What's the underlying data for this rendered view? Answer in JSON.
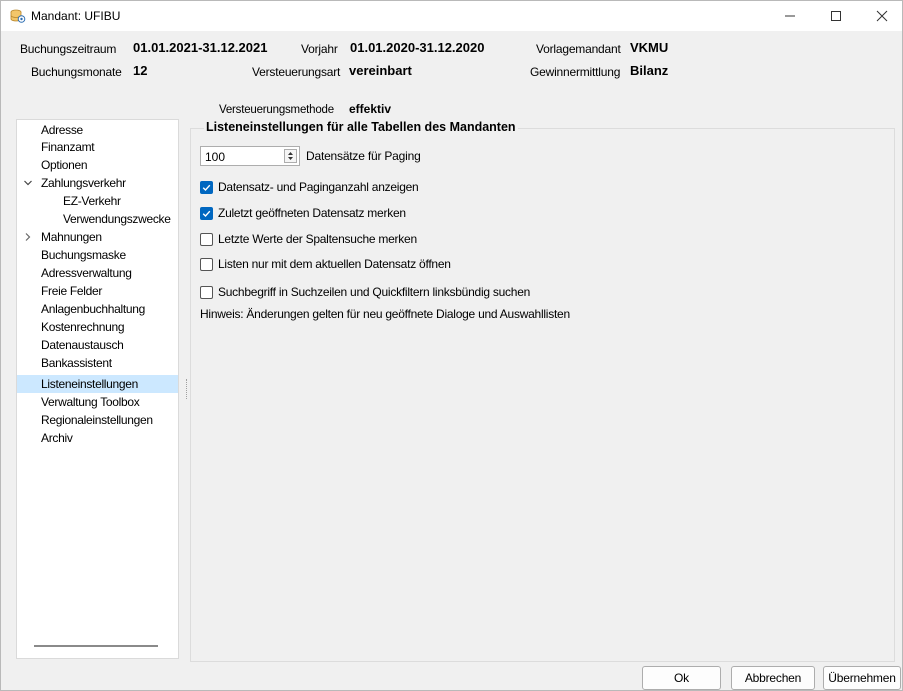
{
  "window": {
    "title": "Mandant: UFIBU",
    "minimize": "—",
    "maximize": "☐",
    "close": "✕"
  },
  "header": {
    "buchungszeitraum_label": "Buchungszeitraum",
    "buchungszeitraum_value": "01.01.2021-31.12.2021",
    "vorjahr_label": "Vorjahr",
    "vorjahr_value": "01.01.2020-31.12.2020",
    "vorlagemandant_label": "Vorlagemandant",
    "vorlagemandant_value": "VKMU",
    "buchungsmonate_label": "Buchungsmonate",
    "buchungsmonate_value": "12",
    "versteuerungsart_label": "Versteuerungsart",
    "versteuerungsart_value": "vereinbart",
    "gewinnermittlung_label": "Gewinnermittlung",
    "gewinnermittlung_value": "Bilanz",
    "versteuerungsmethode_label": "Versteuerungsmethode",
    "versteuerungsmethode_value": "effektiv"
  },
  "tree": {
    "items": [
      {
        "label": "Adresse",
        "arrow": ""
      },
      {
        "label": "Finanzamt",
        "arrow": ""
      },
      {
        "label": "Optionen",
        "arrow": ""
      },
      {
        "label": "Zahlungsverkehr",
        "arrow": "⌄"
      },
      {
        "label": "EZ-Verkehr",
        "arrow": ""
      },
      {
        "label": "Verwendungszwecke",
        "arrow": ""
      },
      {
        "label": "Mahnungen",
        "arrow": "›"
      },
      {
        "label": "Buchungsmaske",
        "arrow": ""
      },
      {
        "label": "Adressverwaltung",
        "arrow": ""
      },
      {
        "label": "Freie Felder",
        "arrow": ""
      },
      {
        "label": "Anlagenbuchhaltung",
        "arrow": ""
      },
      {
        "label": "Kostenrechnung",
        "arrow": ""
      },
      {
        "label": "Datenaustausch",
        "arrow": ""
      },
      {
        "label": "Bankassistent",
        "arrow": ""
      },
      {
        "label": "Listeneinstellungen",
        "arrow": ""
      },
      {
        "label": "Verwaltung Toolbox",
        "arrow": ""
      },
      {
        "label": "Regionaleinstellungen",
        "arrow": ""
      },
      {
        "label": "Archiv",
        "arrow": ""
      }
    ]
  },
  "panel": {
    "group_title": "Listeneinstellungen für alle Tabellen des Mandanten",
    "paging_value": "100",
    "paging_label": "Datensätze für Paging",
    "checkboxes": [
      {
        "label": "Datensatz- und Paginganzahl anzeigen",
        "checked": true
      },
      {
        "label": "Zuletzt geöffneten Datensatz merken",
        "checked": true
      },
      {
        "label": "Letzte Werte der Spaltensuche merken",
        "checked": false
      },
      {
        "label": "Listen nur mit dem aktuellen Datensatz öffnen",
        "checked": false
      },
      {
        "label": "Suchbegriff in Suchzeilen und Quickfiltern linksbündig suchen",
        "checked": false
      }
    ],
    "hint": "Hinweis: Änderungen gelten für neu geöffnete Dialoge und Auswahllisten"
  },
  "buttons": {
    "ok": "Ok",
    "abbrechen": "Abbrechen",
    "uebernehmen": "Übernehmen"
  },
  "colors": {
    "accent": "#0067c0",
    "selection": "#cce8ff"
  }
}
